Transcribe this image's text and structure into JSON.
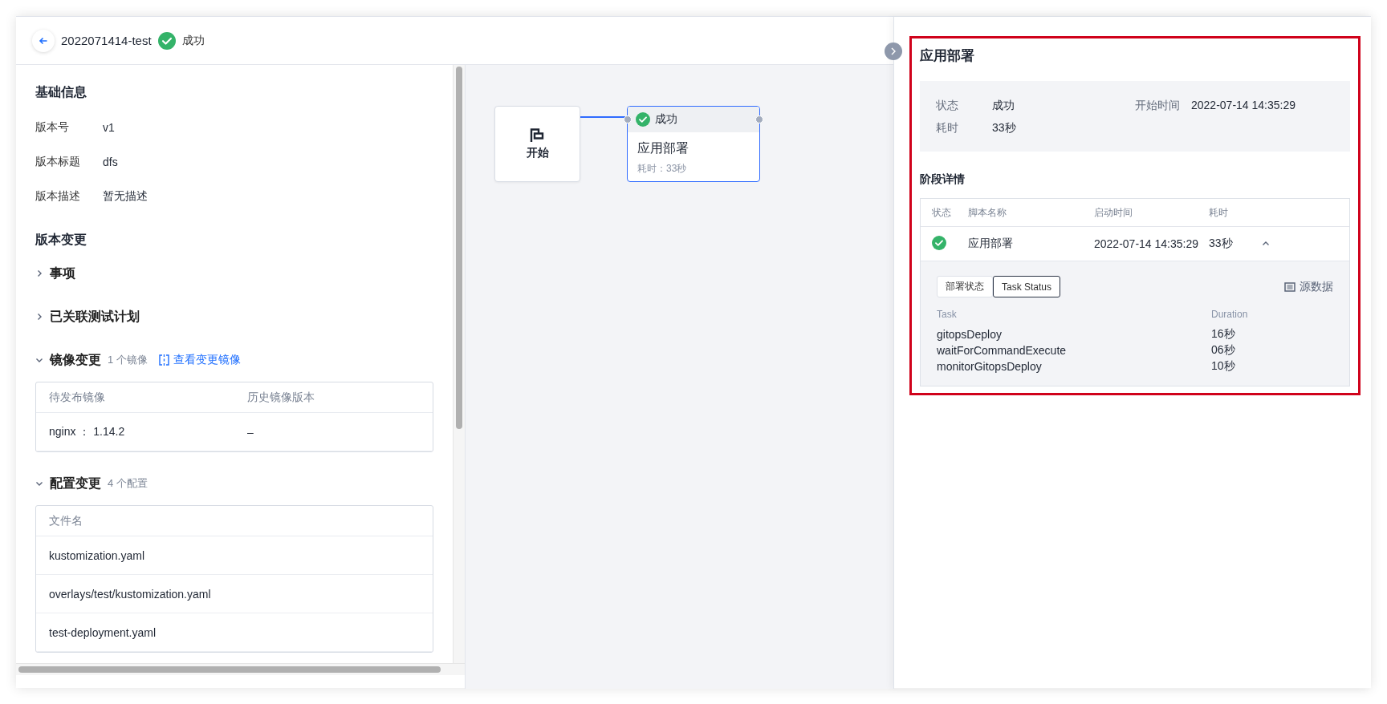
{
  "header": {
    "title": "2022071414-test",
    "status": {
      "kind": "success",
      "label": "成功"
    }
  },
  "basic_info": {
    "heading": "基础信息",
    "fields": [
      {
        "label": "版本号",
        "value": "v1"
      },
      {
        "label": "版本标题",
        "value": "dfs"
      },
      {
        "label": "版本描述",
        "value": "暂无描述"
      }
    ]
  },
  "changes": {
    "heading": "版本变更",
    "sections": [
      {
        "title": "事项",
        "expanded": false
      },
      {
        "title": "已关联测试计划",
        "expanded": false
      },
      {
        "title": "镜像变更",
        "expanded": true,
        "count": "1 个镜像",
        "link": "查看变更镜像",
        "table": {
          "columns": [
            "待发布镜像",
            "历史镜像版本"
          ],
          "rows": [
            [
              "nginx ：  1.14.2",
              "–"
            ]
          ]
        }
      },
      {
        "title": "配置变更",
        "expanded": true,
        "count": "4 个配置",
        "table": {
          "columns": [
            "文件名"
          ],
          "rows": [
            [
              "kustomization.yaml"
            ],
            [
              "overlays/test/kustomization.yaml"
            ],
            [
              "test-deployment.yaml"
            ]
          ]
        }
      }
    ]
  },
  "canvas": {
    "nodes": [
      {
        "kind": "start",
        "label": "开始"
      },
      {
        "kind": "stage",
        "selected": true,
        "status": {
          "kind": "success",
          "label": "成功"
        },
        "name": "应用部署",
        "duration": "耗时：33秒"
      }
    ]
  },
  "detail_panel": {
    "title": "应用部署",
    "info": [
      {
        "label": "状态",
        "value": "成功"
      },
      {
        "label": "开始时间",
        "value": "2022-07-14 14:35:29"
      },
      {
        "label": "耗时",
        "value": "33秒"
      }
    ],
    "stage_heading": "阶段详情",
    "stage_table": {
      "columns": [
        "状态",
        "脚本名称",
        "启动时间",
        "耗时"
      ],
      "rows": [
        {
          "kind": "success",
          "name": "应用部署",
          "start_time": "2022-07-14 14:35:29",
          "duration": "33秒",
          "expanded": true,
          "tabs": [
            {
              "label": "部署状态",
              "selected": false
            },
            {
              "label": "Task Status",
              "selected": true
            }
          ],
          "source_link": "源数据",
          "tasks": {
            "columns": [
              "Task",
              "Duration"
            ],
            "rows": [
              [
                "gitopsDeploy",
                "16秒"
              ],
              [
                "waitForCommandExecute",
                "06秒"
              ],
              [
                "monitorGitopsDeploy",
                "10秒"
              ]
            ]
          }
        }
      ]
    }
  }
}
